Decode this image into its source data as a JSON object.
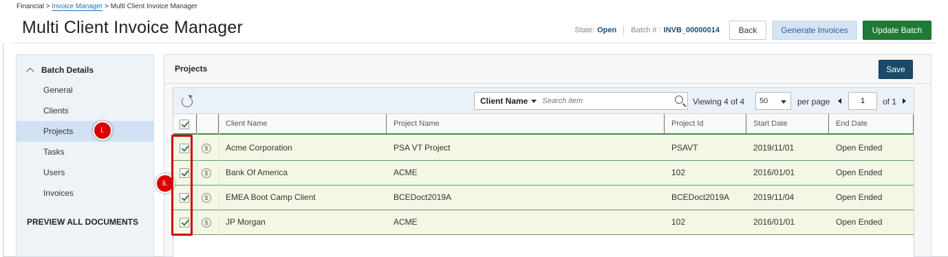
{
  "breadcrumb": {
    "part1": "Financial >",
    "link": "Invoice Manager",
    "part3": "> Multi Client Invoice Manager"
  },
  "page_title": "Multi Client Invoice Manager",
  "header": {
    "state_label": "State:",
    "state_value": "Open",
    "batch_label": "Batch # :",
    "batch_value": "INVB_00000014",
    "back_label": "Back",
    "generate_label": "Generate Invoices",
    "update_label": "Update Batch"
  },
  "sidebar": {
    "heading": "Batch Details",
    "items": [
      {
        "label": "General"
      },
      {
        "label": "Clients"
      },
      {
        "label": "Projects"
      },
      {
        "label": "Tasks"
      },
      {
        "label": "Users"
      },
      {
        "label": "Invoices"
      }
    ],
    "active_item": "Projects",
    "preview_label": "PREVIEW ALL DOCUMENTS"
  },
  "markers": {
    "m1": "i.",
    "m2": "ii."
  },
  "main": {
    "title": "Projects",
    "save_label": "Save",
    "toolbar": {
      "filter_label": "Client Name",
      "search_placeholder": "Search item",
      "viewing_text": "Viewing",
      "viewing_count": "4 of 4",
      "per_page_value": "50",
      "per_page_label": "per page",
      "page_value": "1",
      "page_of": "of 1"
    },
    "columns": [
      "Client Name",
      "Project Name",
      "Project Id",
      "Start Date",
      "End Date"
    ],
    "rows": [
      {
        "client": "Acme Corporation",
        "project": "PSA VT Project",
        "id": "PSAVT",
        "start": "2019/11/01",
        "end": "Open Ended"
      },
      {
        "client": "Bank Of America",
        "project": "ACME",
        "id": "102",
        "start": "2016/01/01",
        "end": "Open Ended"
      },
      {
        "client": "EMEA Boot Camp Client",
        "project": "BCEDoct2019A",
        "id": "BCEDoct2019A",
        "start": "2019/11/04",
        "end": "Open Ended"
      },
      {
        "client": "JP Morgan",
        "project": "ACME",
        "id": "102",
        "start": "2016/01/01",
        "end": "Open Ended"
      }
    ],
    "dollar_icon": "$"
  },
  "colors": {
    "accent_green": "#1f7a34",
    "save_navy": "#1b4a6b",
    "marker_red": "#d90000",
    "row_highlight": "#f4f7e3"
  }
}
